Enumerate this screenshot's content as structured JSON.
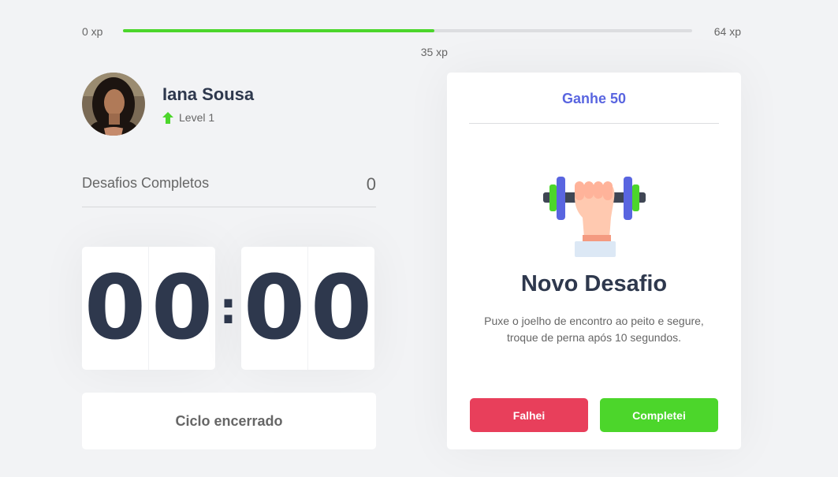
{
  "xp": {
    "min_label": "0 xp",
    "max_label": "64 xp",
    "current_label": "35 xp",
    "current": 35,
    "max": 64
  },
  "profile": {
    "name": "Iana Sousa",
    "level_label": "Level 1"
  },
  "challenges": {
    "label": "Desafios Completos",
    "count": "0"
  },
  "countdown": {
    "m1": "0",
    "m2": "0",
    "separator": ":",
    "s1": "0",
    "s2": "0"
  },
  "cycle_button": "Ciclo encerrado",
  "card": {
    "header": "Ganhe 50",
    "title": "Novo Desafio",
    "description": "Puxe o joelho de encontro ao peito e segure, troque de perna após 10 segundos.",
    "failed_label": "Falhei",
    "completed_label": "Completei"
  },
  "colors": {
    "accent_blue": "#5965e0",
    "green": "#4cd62b",
    "red": "#e83f5b",
    "title": "#2e384d"
  },
  "icons": {
    "level": "level-up-arrow-icon",
    "challenge": "dumbbell-icon"
  }
}
